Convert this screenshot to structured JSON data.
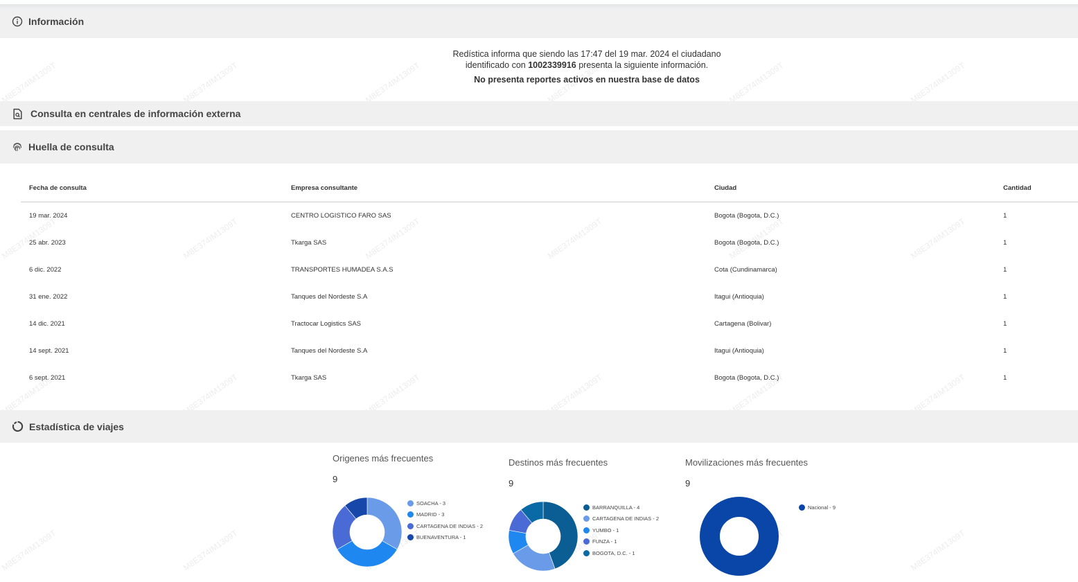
{
  "sections": {
    "info_title": "Información",
    "consulta_title": "Consulta en centrales de información externa",
    "huella_title": "Huella de consulta",
    "estadistica_title": "Estadística de viajes"
  },
  "info": {
    "line1": "Redística informa que siendo las 17:47 del 19 mar. 2024 el ciudadano",
    "line2_prefix": "identificado con ",
    "document_number": "1002339916",
    "line2_suffix": " presenta la siguiente información.",
    "status": "No presenta reportes activos en nuestra base de datos"
  },
  "table": {
    "headers": [
      "Fecha de consulta",
      "Empresa consultante",
      "Ciudad",
      "Cantidad"
    ],
    "rows": [
      [
        "19 mar. 2024",
        "CENTRO LOGISTICO FARO SAS",
        "Bogota (Bogota, D.C.)",
        "1"
      ],
      [
        "25 abr. 2023",
        "Tkarga SAS",
        "Bogota (Bogota, D.C.)",
        "1"
      ],
      [
        "6 dic. 2022",
        "TRANSPORTES HUMADEA S.A.S",
        "Cota (Cundinamarca)",
        "1"
      ],
      [
        "31 ene. 2022",
        "Tanques del Nordeste S.A",
        "Itagui (Antioquia)",
        "1"
      ],
      [
        "14 dic. 2021",
        "Tractocar Logistics SAS",
        "Cartagena (Bolivar)",
        "1"
      ],
      [
        "14 sept. 2021",
        "Tanques del Nordeste S.A",
        "Itagui (Antioquia)",
        "1"
      ],
      [
        "6 sept. 2021",
        "Tkarga SAS",
        "Bogota (Bogota, D.C.)",
        "1"
      ]
    ]
  },
  "watermark": "M8E374IM1309T",
  "chart_data": [
    {
      "type": "pie",
      "title": "Origenes más frecuentes",
      "total": "9",
      "categories": [
        "SOACHA",
        "MADRID",
        "CARTAGENA DE INDIAS",
        "BUENAVENTURA"
      ],
      "values": [
        3,
        3,
        2,
        1
      ],
      "legend_labels": [
        "SOACHA - 3",
        "MADRID - 3",
        "CARTAGENA DE INDIAS - 2",
        "BUENAVENTURA - 1"
      ],
      "colors": [
        "#6a9be8",
        "#1e87f0",
        "#4a6bd6",
        "#1747a8"
      ],
      "legend": "right"
    },
    {
      "type": "pie",
      "title": "Destinos más frecuentes",
      "total": "9",
      "categories": [
        "BARRANQUILLA",
        "CARTAGENA DE INDIAS",
        "YUMBO",
        "FUNZA",
        "BOGOTA, D.C."
      ],
      "values": [
        4,
        2,
        1,
        1,
        1
      ],
      "legend_labels": [
        "BARRANQUILLA - 4",
        "CARTAGENA DE INDIAS - 2",
        "YUMBO - 1",
        "FUNZA - 1",
        "BOGOTA, D.C. - 1"
      ],
      "colors": [
        "#0b5e94",
        "#6a9be8",
        "#1e87f0",
        "#4a6bd6",
        "#0a6aa6"
      ],
      "legend": "right"
    },
    {
      "type": "pie",
      "title": "Movilizaciones más frecuentes",
      "total": "9",
      "categories": [
        "Nacional"
      ],
      "values": [
        9
      ],
      "legend_labels": [
        "Nacional - 9"
      ],
      "colors": [
        "#0a46a8"
      ],
      "legend": "right"
    }
  ]
}
